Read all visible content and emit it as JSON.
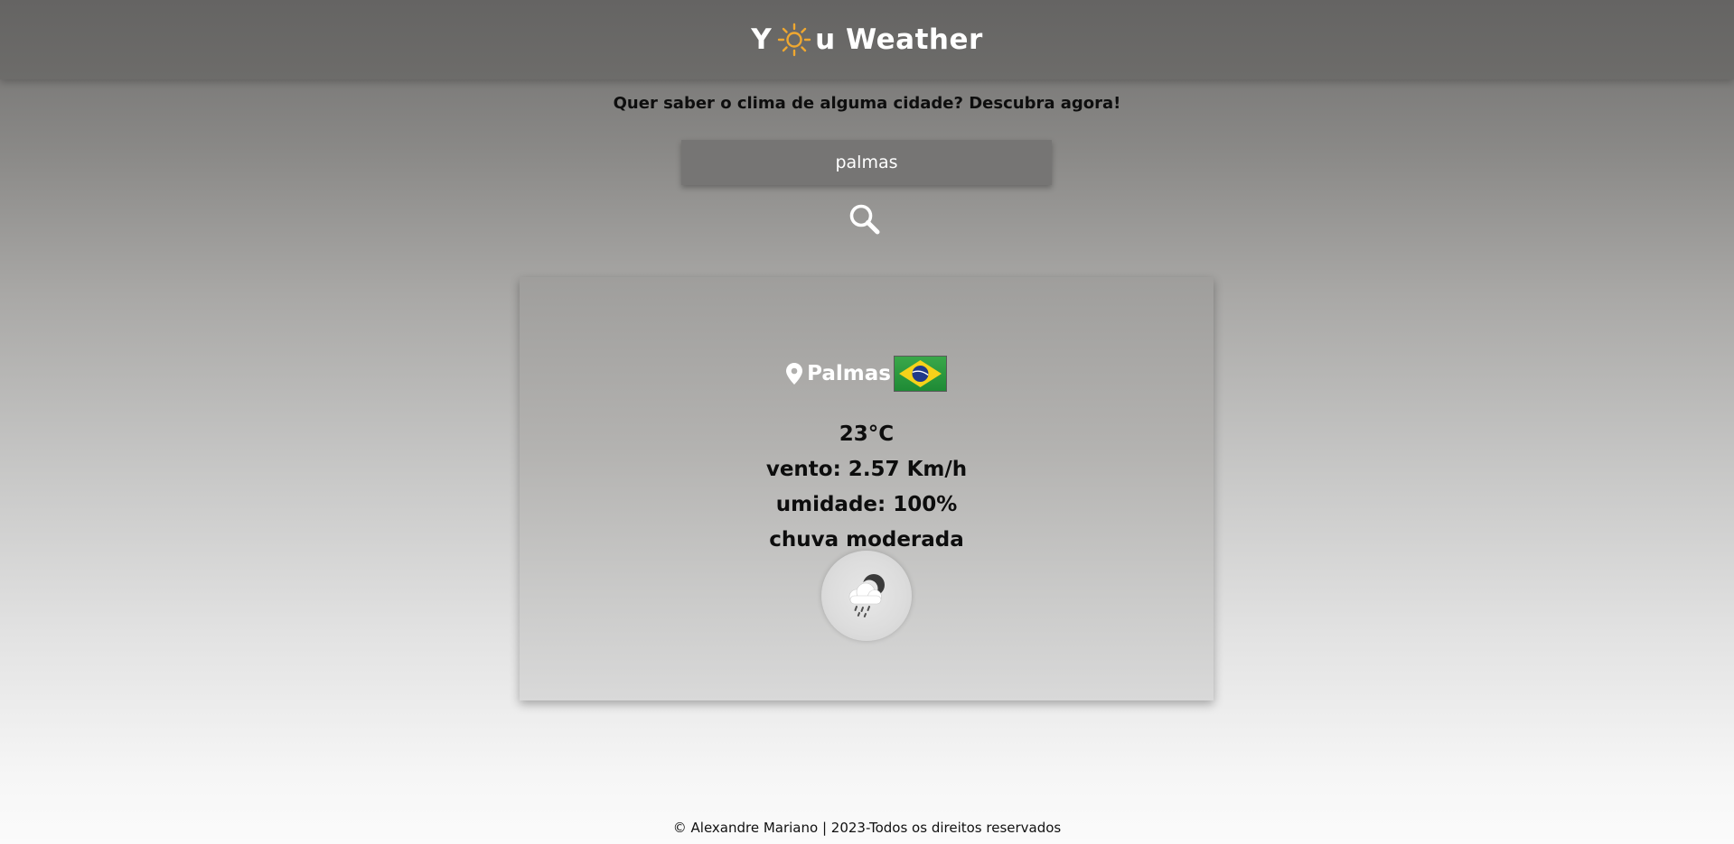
{
  "header": {
    "logo_prefix": "Y",
    "logo_suffix": "u Weather",
    "logo_icon": "sun-icon"
  },
  "tagline": "Quer saber o clima de alguma cidade? Descubra agora!",
  "search": {
    "value": "palmas",
    "button_icon": "search-icon"
  },
  "weather": {
    "city": "Palmas",
    "country_flag": "brazil-flag-icon",
    "temperature": "23°C",
    "wind": "vento: 2.57 Km/h",
    "humidity": "umidade: 100%",
    "description": "chuva moderada",
    "condition_icon": "rain-cloud-night-icon"
  },
  "footer": "© Alexandre Mariano | 2023-Todos os direitos reservados",
  "colors": {
    "accent_sun": "#f0a830",
    "header_bg": "#676665",
    "input_bg": "#767574"
  }
}
